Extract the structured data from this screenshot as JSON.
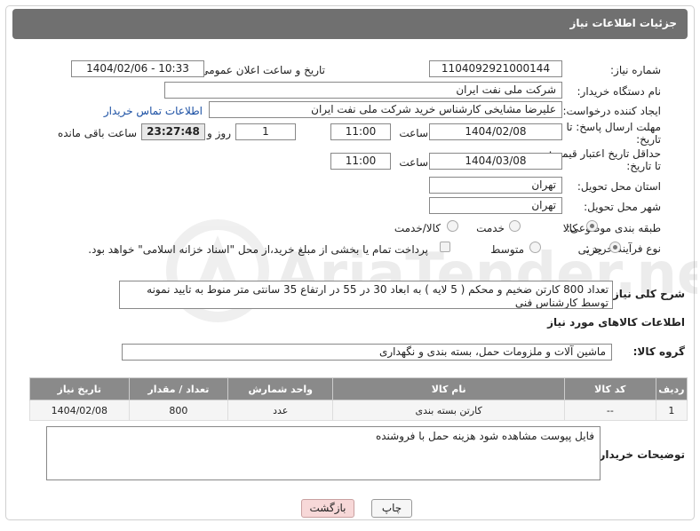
{
  "header": {
    "title": "جزئیات اطلاعات نیاز"
  },
  "fields": {
    "need_number_label": "شماره نیاز:",
    "need_number": "1104092921000144",
    "announce_label": "تاریخ و ساعت اعلان عمومی:",
    "announce_value": "1404/02/06 - 10:33",
    "buyer_org_label": "نام دستگاه خریدار:",
    "buyer_org": "شرکت ملی نفت ایران",
    "requester_label": "ایجاد کننده درخواست:",
    "requester": "علیرضا مشایخی کارشناس خرید  شرکت ملی نفت ایران",
    "contact_link": "اطلاعات تماس خریدار",
    "deadline_label_1": "مهلت ارسال پاسخ: تا",
    "deadline_label_2": "تاریخ:",
    "deadline_date": "1404/02/08",
    "time_label": "ساعت",
    "deadline_time": "11:00",
    "days_value": "1",
    "days_label": "روز و",
    "remaining_time": "23:27:48",
    "remaining_label": "ساعت باقی مانده",
    "price_validity_label_1": "حداقل تاریخ اعتبار قیمت:",
    "price_validity_label_2": "تا تاریخ:",
    "price_validity_date": "1404/03/08",
    "price_validity_time": "11:00",
    "province_label": "استان محل تحویل:",
    "province": "تهران",
    "city_label": "شهر محل تحویل:",
    "city": "تهران",
    "category_label": "طبقه بندی موضوعی:",
    "category_options": [
      "کالا",
      "خدمت",
      "کالا/خدمت"
    ],
    "process_label": "نوع فرآیند خرید :",
    "process_options": [
      "جزیی",
      "متوسط"
    ],
    "payment_note": "پرداخت تمام یا بخشی از مبلغ خرید،از محل \"اسناد خزانه اسلامی\" خواهد بود.",
    "description_label": "شرح کلی نیاز:",
    "description": "تعداد 800 کارتن ضخیم و محکم ( 5 لایه ) به ابعاد 30 در 55 در ارتفاع 35 سانتی متر  منوط به تایید نمونه توسط کارشناس فنی",
    "goods_info_title": "اطلاعات کالاهای مورد نیاز",
    "goods_group_label": "گروه کالا:",
    "goods_group": "ماشین آلات و ملزومات حمل، بسته بندی و نگهداری",
    "buyer_notes_label": "توضیحات خریدار:",
    "buyer_notes": "فایل پیوست مشاهده شود هزینه حمل با فروشنده"
  },
  "table": {
    "headers": [
      "ردیف",
      "کد کالا",
      "نام کالا",
      "واحد شمارش",
      "تعداد / مقدار",
      "تاریخ نیاز"
    ],
    "rows": [
      [
        "1",
        "--",
        "کارتن بسته بندی",
        "عدد",
        "800",
        "1404/02/08"
      ]
    ]
  },
  "buttons": {
    "print": "چاپ",
    "back": "بازگشت"
  },
  "watermark": {
    "text": "AriaTender.neT"
  },
  "colors": {
    "header_bg": "#707070",
    "table_header_bg": "#8a8a8a",
    "link": "#1a4fa3",
    "back_button_bg": "#f7d8d8"
  }
}
